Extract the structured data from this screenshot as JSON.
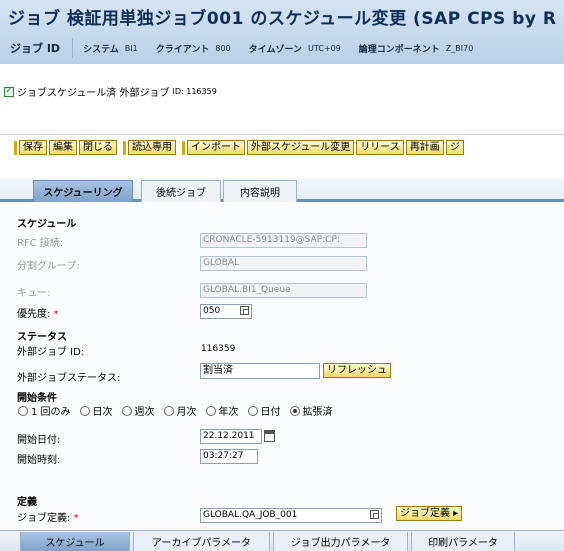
{
  "header": {
    "title": "ジョブ 検証用単独ジョブ001 のスケジュール変更 (SAP CPS by R",
    "job_id_label": "ジョブ ID",
    "system_label": "システム",
    "system_value": "BI1",
    "client_label": "クライアント",
    "client_value": "800",
    "timezone_label": "タイムゾーン",
    "timezone_value": "UTC+09",
    "component_label": "論理コンポーネント",
    "component_value": "Z_BI70"
  },
  "status": {
    "text": "ジョブスケジュール済 外部ジョブ",
    "id_text": "ID: 116359"
  },
  "toolbar": {
    "groups": [
      [
        "保存",
        "編集",
        "閉じる"
      ],
      [
        "読込専用"
      ],
      [
        "インポート",
        "外部スケジュール変更",
        "リリース",
        "再計画",
        "ジ"
      ]
    ]
  },
  "tabs_top": [
    "スケジューリング",
    "後続ジョブ",
    "内容説明"
  ],
  "form": {
    "schedule_section": "スケジュール",
    "rfc_label": "RFC 接続:",
    "rfc_value": "CRONACLE-5913119@SAP:CP:",
    "split_group_label": "分割グループ:",
    "split_group_value": "GLOBAL",
    "queue_label": "キュー:",
    "queue_value": "GLOBAL.BI1_Queue",
    "priority_label": "優先度:",
    "priority_value": "050",
    "status_section": "ステータス",
    "ext_job_id_label": "外部ジョブ ID:",
    "ext_job_id_value": "116359",
    "ext_job_status_label": "外部ジョブステータス:",
    "ext_job_status_value": "割当済",
    "refresh_button": "リフレッシュ",
    "start_condition_section": "開始条件",
    "radio_options": [
      "1 回のみ",
      "日次",
      "週次",
      "月次",
      "年次",
      "日付",
      "拡張済"
    ],
    "radio_selected": 6,
    "start_date_label": "開始日付:",
    "start_date_value": "22.12.2011",
    "start_time_label": "開始時刻:",
    "start_time_value": "03:27:27",
    "definition_section": "定義",
    "job_def_label": "ジョブ定義:",
    "job_def_value": "GLOBAL.QA_JOB_001",
    "job_def_button": "ジョブ定義"
  },
  "tabs_bottom": [
    "スケジュール",
    "アーカイブパラメータ",
    "ジョブ出力パラメータ",
    "印刷パラメータ"
  ]
}
